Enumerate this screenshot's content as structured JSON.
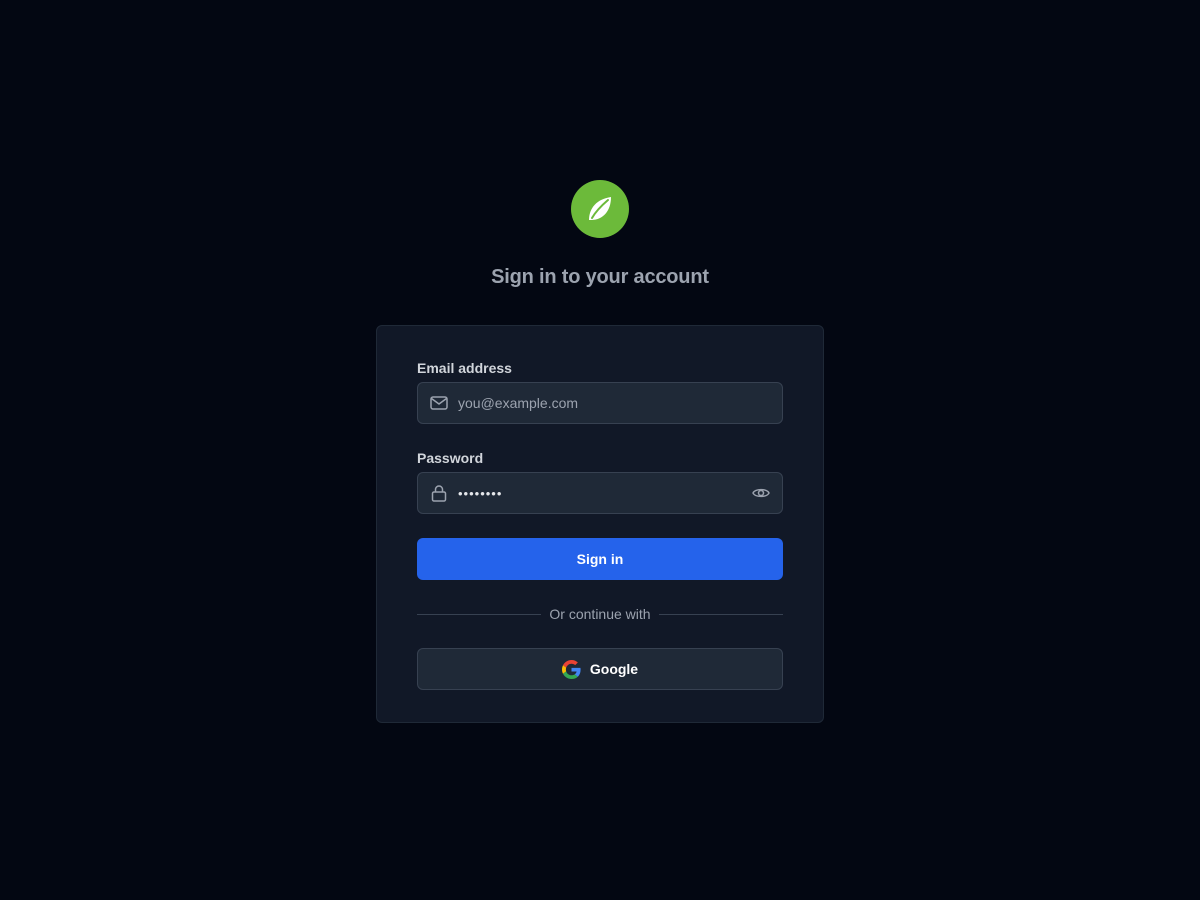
{
  "header": {
    "title": "Sign in to your account"
  },
  "form": {
    "email": {
      "label": "Email address",
      "placeholder": "you@example.com",
      "value": ""
    },
    "password": {
      "label": "Password",
      "value": "password",
      "masked": true
    },
    "submit_label": "Sign in",
    "divider_text": "Or continue with",
    "providers": [
      {
        "label": "Google",
        "icon": "google-icon"
      }
    ]
  },
  "icons": {
    "logo": "leaf-icon",
    "email": "mail-icon",
    "password": "lock-icon",
    "toggle": "eye-icon"
  },
  "colors": {
    "background": "#030712",
    "card": "#111827",
    "input": "#1f2937",
    "primary": "#2563eb",
    "logo": "#6cba3a"
  }
}
